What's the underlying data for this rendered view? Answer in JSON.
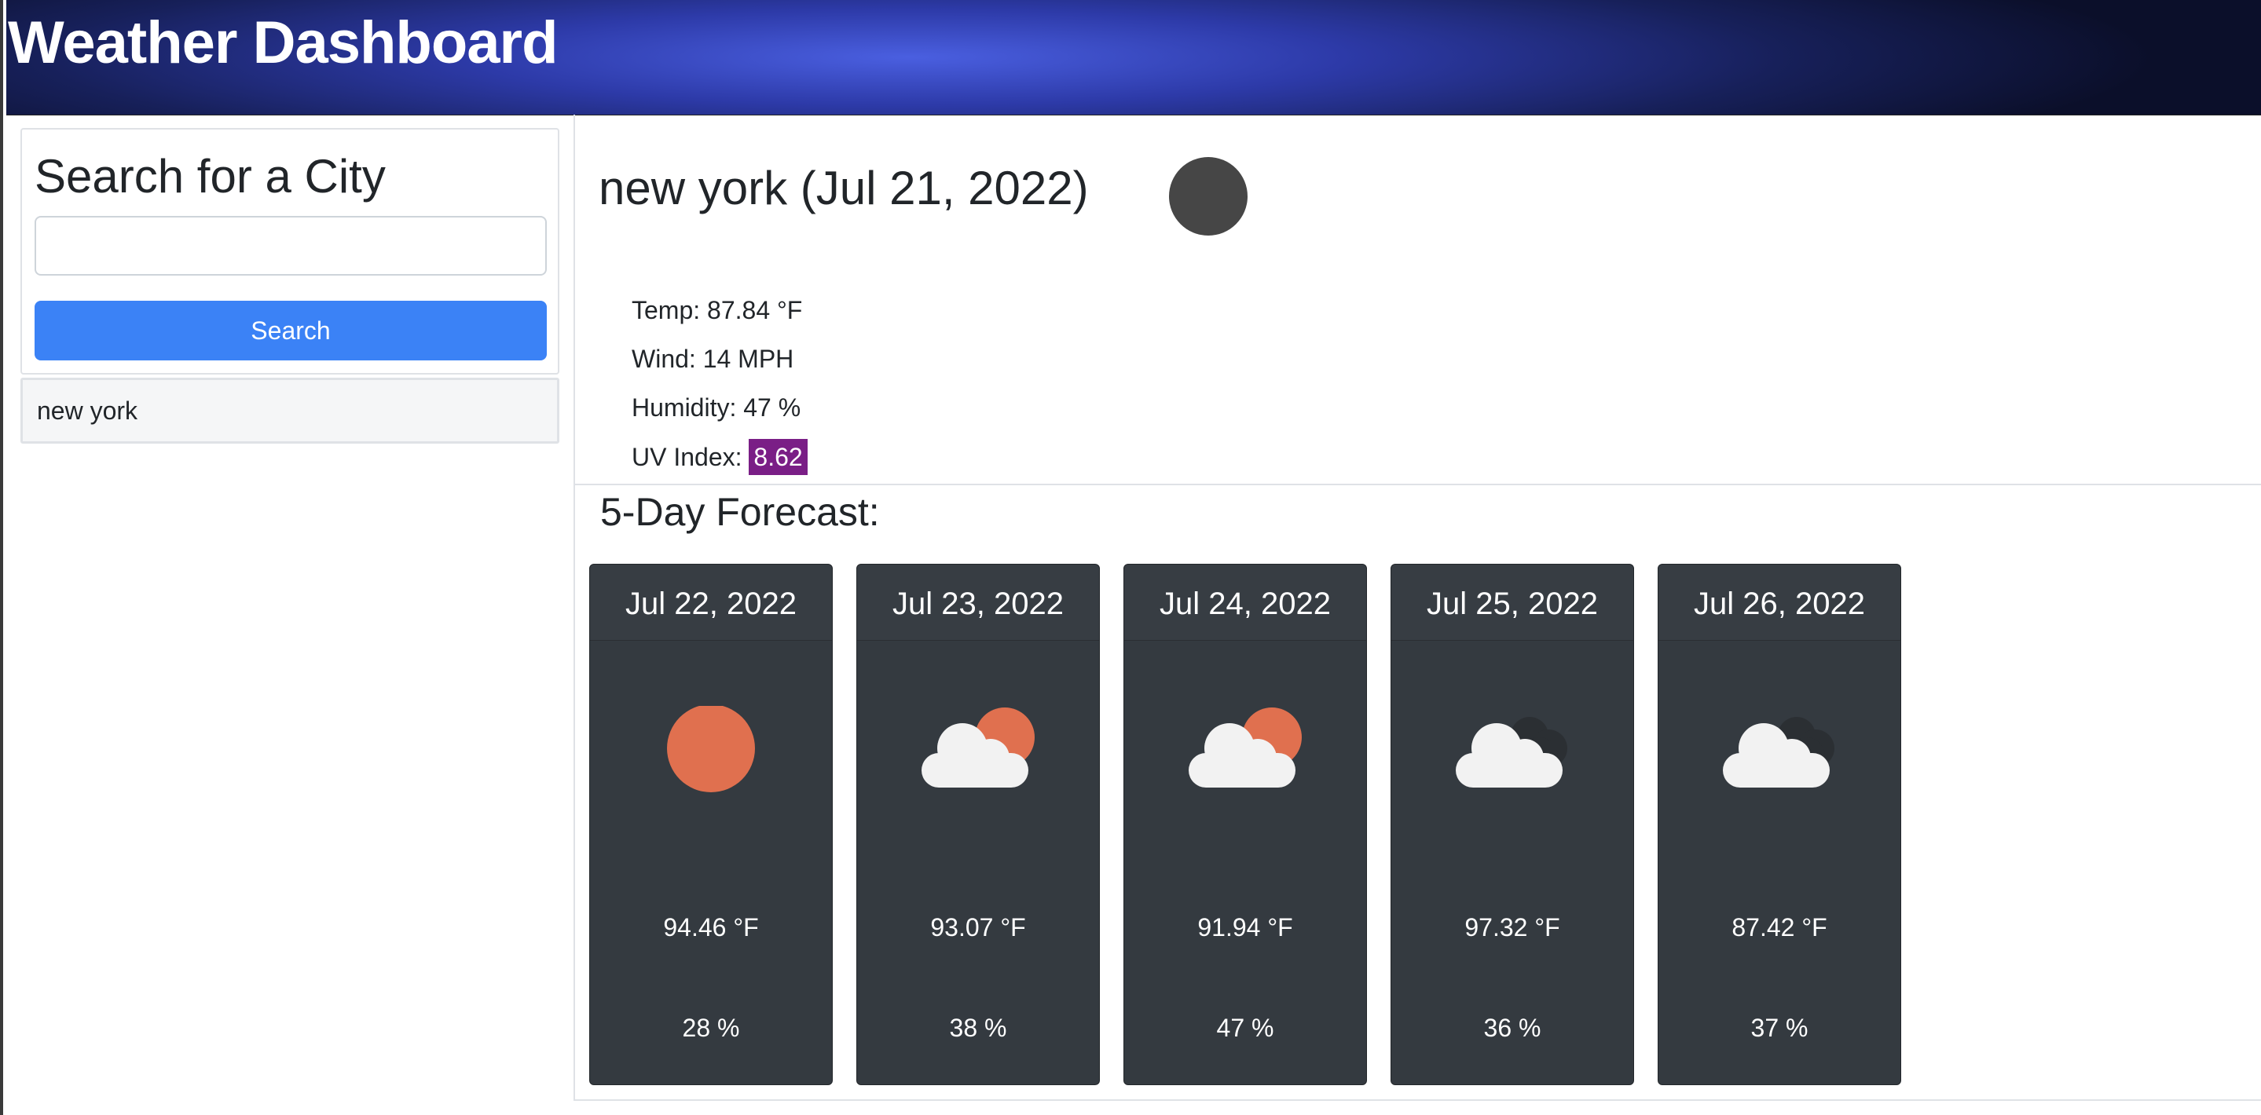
{
  "header": {
    "title": "Weather Dashboard"
  },
  "sidebar": {
    "search_title": "Search for a City",
    "search_input_value": "",
    "search_placeholder": "",
    "search_button": "Search",
    "history": [
      "new york"
    ]
  },
  "current": {
    "title": "new york (Jul 21, 2022)",
    "icon": "dark-circle-weather-icon",
    "temp": "Temp: 87.84 °F",
    "wind": "Wind: 14 MPH",
    "humidity": "Humidity: 47 %",
    "uv_label": "UV Index: ",
    "uv_value": "8.62",
    "uv_color": "#7a1e86"
  },
  "forecast": {
    "title": "5-Day Forecast:",
    "days": [
      {
        "date": "Jul 22, 2022",
        "icon": "sun-icon",
        "temp": "94.46 °F",
        "humidity": "28 %"
      },
      {
        "date": "Jul 23, 2022",
        "icon": "partly-cloudy-icon",
        "temp": "93.07 °F",
        "humidity": "38 %"
      },
      {
        "date": "Jul 24, 2022",
        "icon": "partly-cloudy-icon",
        "temp": "91.94 °F",
        "humidity": "47 %"
      },
      {
        "date": "Jul 25, 2022",
        "icon": "cloudy-icon",
        "temp": "97.32 °F",
        "humidity": "36 %"
      },
      {
        "date": "Jul 26, 2022",
        "icon": "cloudy-icon",
        "temp": "87.42 °F",
        "humidity": "37 %"
      }
    ]
  },
  "colors": {
    "header": "#2d3aa8",
    "button": "#3b82f6",
    "card": "#343a40",
    "sun": "#e0704f"
  }
}
